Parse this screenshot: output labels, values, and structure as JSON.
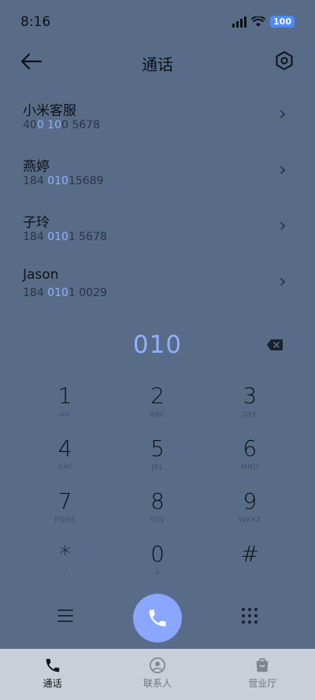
{
  "status_bar": {
    "time": "8:16",
    "battery": "100"
  },
  "header": {
    "title": "通话"
  },
  "contacts": [
    {
      "name": "小米客服",
      "number_pre": "40",
      "number_hl": "0 10",
      "number_post": "0 5678"
    },
    {
      "name": "燕婷",
      "number_pre": "184 ",
      "number_hl": "010",
      "number_post": "15689"
    },
    {
      "name": "子玲",
      "number_pre": "184 ",
      "number_hl": "010",
      "number_post": "1 5678"
    },
    {
      "name": "Jason",
      "number_pre": "184 ",
      "number_hl": "010",
      "number_post": "1 0029"
    }
  ],
  "dialer": {
    "dialed": "010"
  },
  "keypad": [
    {
      "digit": "1",
      "letters": "oo"
    },
    {
      "digit": "2",
      "letters": "ABC"
    },
    {
      "digit": "3",
      "letters": "DEF"
    },
    {
      "digit": "4",
      "letters": "GHI"
    },
    {
      "digit": "5",
      "letters": "JKL"
    },
    {
      "digit": "6",
      "letters": "MNO"
    },
    {
      "digit": "7",
      "letters": "PQRS"
    },
    {
      "digit": "8",
      "letters": "TUV"
    },
    {
      "digit": "9",
      "letters": "WXYZ"
    },
    {
      "digit": "*",
      "letters": ","
    },
    {
      "digit": "0",
      "letters": "+"
    },
    {
      "digit": "#",
      "letters": ""
    }
  ],
  "bottom_nav": [
    {
      "label": "通话",
      "icon": "phone-icon",
      "active": true
    },
    {
      "label": "联系人",
      "icon": "contacts-icon",
      "active": false
    },
    {
      "label": "营业厅",
      "icon": "store-icon",
      "active": false
    }
  ],
  "colors": {
    "accent": "#8fb0ff",
    "call_button": "#8aa6ff",
    "background": "#586c88",
    "nav_background": "#c9cfd8"
  }
}
